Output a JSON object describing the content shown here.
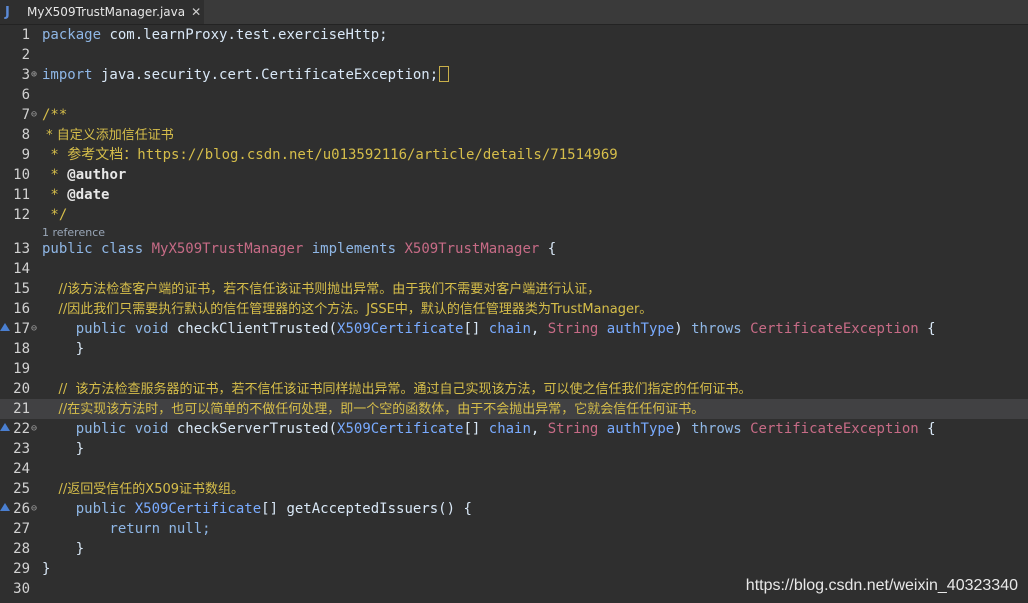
{
  "tab": {
    "title": "MyX509TrustManager.java",
    "file_icon": "J",
    "close": "✕"
  },
  "editor": {
    "lines": {
      "l1": "1",
      "l2": "2",
      "l3": "3",
      "l6": "6",
      "l7": "7",
      "l8": "8",
      "l9": "9",
      "l10": "10",
      "l11": "11",
      "l12": "12",
      "l13": "13",
      "l14": "14",
      "l15": "15",
      "l16": "16",
      "l17": "17",
      "l18": "18",
      "l19": "19",
      "l20": "20",
      "l21": "21",
      "l22": "22",
      "l23": "23",
      "l24": "24",
      "l25": "25",
      "l26": "26",
      "l27": "27",
      "l28": "28",
      "l29": "29",
      "l30": "30"
    },
    "reference_hint": "1 reference",
    "code": {
      "package_kw": "package",
      "package_name": " com.learnProxy.test.exerciseHttp;",
      "import_kw": "import",
      "import_name": " java.security.cert.CertificateException;",
      "doc_open": "/**",
      "doc_line1": " * 自定义添加信任证书",
      "doc_line2": " * 参考文档：https://blog.csdn.net/u013592116/article/details/71514969",
      "doc_author_star": " * ",
      "doc_author": "@author",
      "doc_date_star": " * ",
      "doc_date": "@date",
      "doc_close": " */",
      "class_public": "public",
      "class_kw": " class ",
      "class_name": "MyX509TrustManager",
      "implements_kw": " implements ",
      "iface_name": "X509TrustManager",
      "class_brace": " {",
      "c15": "    //该方法检查客户端的证书，若不信任该证书则抛出异常。由于我们不需要对客户端进行认证，",
      "c16": "    //因此我们只需要执行默认的信任管理器的这个方法。JSSE中，默认的信任管理器类为TrustManager。",
      "m_public": "    public",
      "m_void": " void ",
      "m_client": "checkClientTrusted(",
      "m_server": "checkServerTrusted(",
      "m_cert_type": "X509Certificate",
      "m_arr": "[] ",
      "m_chain": "chain",
      "m_comma": ", ",
      "m_string": "String",
      "m_space": " ",
      "m_authtype": "authType",
      "m_paren": ") ",
      "m_throws": "throws",
      "m_exc": "CertificateException",
      "m_brace": " {",
      "close_brace_ind": "    }",
      "c20": "    //  该方法检查服务器的证书，若不信任该证书同样抛出异常。通过自己实现该方法，可以使之信任我们指定的任何证书。",
      "c21": "    //在实现该方法时，也可以简单的不做任何处理，即一个空的函数体，由于不会抛出异常，它就会信任任何证书。",
      "c25": "    //返回受信任的X509证书数组。",
      "g_public": "    public ",
      "g_type": "X509Certificate",
      "g_rest": "[] getAcceptedIssuers() {",
      "r_return": "        return",
      "r_null": " null;",
      "close_brace": "}"
    }
  },
  "watermark": "https://blog.csdn.net/weixin_40323340",
  "colors": {
    "background": "#2f2f2f",
    "comment": "#d6be4a",
    "class": "#c76b86",
    "param": "#79abff",
    "current_line": "#414143"
  },
  "icons": {
    "fold": "fold-toggle-icon",
    "override": "override-marker-icon",
    "file": "java-file-icon"
  }
}
